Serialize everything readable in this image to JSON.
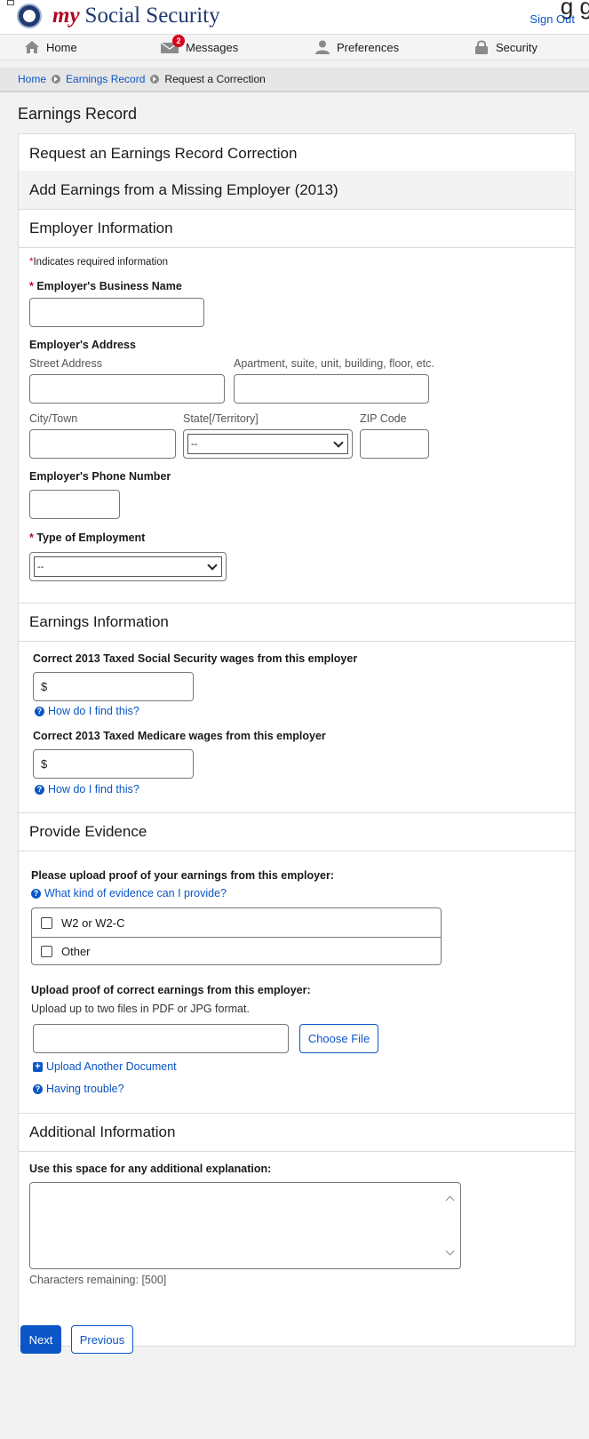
{
  "header": {
    "brand_my": "my",
    "brand_rest": "Social Security",
    "sign_out": "Sign Out",
    "cut_text": "g  g"
  },
  "nav": {
    "home": "Home",
    "messages": "Messages",
    "messages_badge": "2",
    "preferences": "Preferences",
    "security": "Security"
  },
  "breadcrumb": {
    "home": "Home",
    "earnings_record": "Earnings Record",
    "current": "Request a Correction"
  },
  "page_title": "Earnings Record",
  "sections": {
    "request": "Request an Earnings Record Correction",
    "add_earnings": "Add Earnings from a Missing Employer (2013)",
    "employer_info": "Employer Information",
    "earnings_info": "Earnings Information",
    "evidence": "Provide Evidence",
    "additional": "Additional Information"
  },
  "employer": {
    "required_note": "Indicates required information",
    "business_name_label": "Employer's Business Name",
    "address_label": "Employer's Address",
    "street_label": "Street Address",
    "apt_label": "Apartment, suite, unit, building, floor, etc.",
    "city_label": "City/Town",
    "state_label": "State[/Territory]",
    "state_value": "--",
    "zip_label": "ZIP Code",
    "phone_label": "Employer's Phone Number",
    "employment_type_label": "Type of Employment",
    "employment_type_value": "--"
  },
  "earnings": {
    "ss_wages_label": "Correct 2013 Taxed Social Security wages from this employer",
    "medicare_wages_label": "Correct 2013 Taxed Medicare wages from this employer",
    "currency": "$",
    "help_link": "How do I find this?"
  },
  "evidence": {
    "upload_prompt": "Please upload proof of your earnings from this employer:",
    "evidence_help": "What kind of evidence can I provide?",
    "options": [
      "W2 or W2-C",
      "Other"
    ],
    "upload_label": "Upload proof of correct earnings from this employer:",
    "upload_note": "Upload up to two files in PDF or JPG format.",
    "choose_file": "Choose File",
    "upload_another": "Upload Another Document",
    "having_trouble": "Having trouble?"
  },
  "additional": {
    "explanation_label": "Use this space for any additional explanation:",
    "chars_remaining": "Characters remaining: [500]"
  },
  "buttons": {
    "next": "Next",
    "previous": "Previous"
  }
}
